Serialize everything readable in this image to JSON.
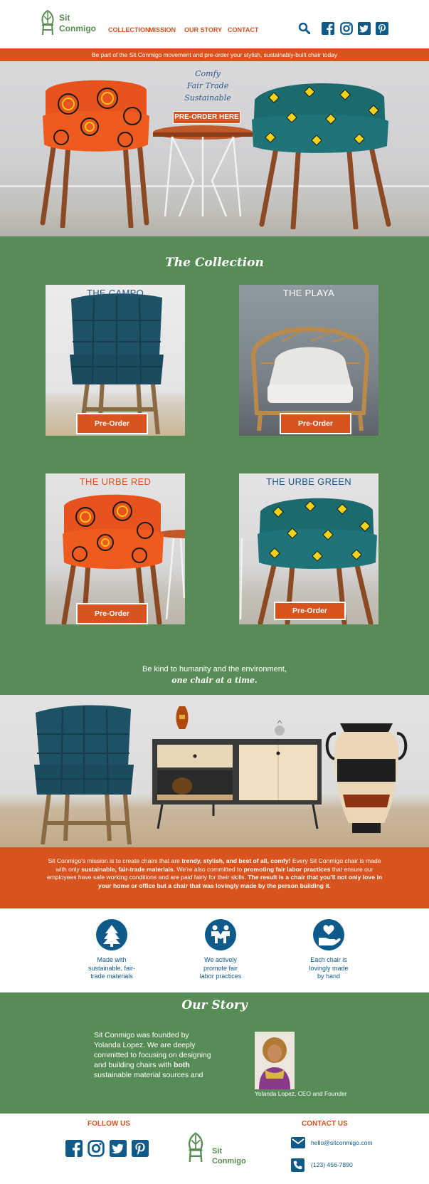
{
  "header": {
    "logo_line1": "Sit",
    "logo_line2": "Conmigo",
    "nav": [
      "COLLECTION",
      "MISSION",
      "OUR STORY",
      "CONTACT"
    ]
  },
  "banner": "Be part of the Sit Conmigo movement and pre-order your stylish, sustainably-built chair today",
  "hero": {
    "tagline": [
      "Comfy",
      "Fair Trade",
      "Sustainable"
    ],
    "cta": "PRE-ORDER HERE"
  },
  "collection": {
    "title": "The Collection",
    "items": [
      {
        "name": "THE CAMPO",
        "button": "Pre-Order"
      },
      {
        "name": "THE PLAYA",
        "button": "Pre-Order"
      },
      {
        "name": "THE URBE RED",
        "button": "Pre-Order"
      },
      {
        "name": "THE URBE GREEN",
        "button": "Pre-Order"
      }
    ],
    "tagline_line1": "Be kind to humanity and the environment,",
    "tagline_line2": "one chair at a time."
  },
  "mission": {
    "p1": "Sit Conmigo's mission is to create chairs that are ",
    "b1": "trendy, stylish, and best of all, comfy!",
    "p2": " Every Sit Conmigo chair is made with only ",
    "b2": "sustainable, fair-trade materials.",
    "p3": " We're also committed to ",
    "b3": "promoting fair labor practices",
    "p4": " that ensure our employees have safe working conditions and are paid fairly for their skills. ",
    "b4": "The result is a chair that you'll not only love in your home or office but a chair that was lovingly made by the person building it."
  },
  "features": [
    {
      "icon": "tree-icon",
      "text": [
        "Made with",
        "sustainable, fair-",
        "trade materials"
      ]
    },
    {
      "icon": "handshake-icon",
      "text": [
        "We actively",
        "promote fair",
        "labor practices"
      ]
    },
    {
      "icon": "heart-hand-icon",
      "text": [
        "Each chair is",
        "lovingly made",
        "by hand"
      ]
    }
  ],
  "story": {
    "title": "Our Story",
    "text_a": "Sit Conmigo was founded by Yolanda Lopez. We are deeply committed to focusing on designing and building chairs with ",
    "text_b": "both",
    "text_c": " sustainable material sources and",
    "caption": "Yolanda Lopez, CEO and Founder"
  },
  "footer": {
    "follow": "FOLLOW US",
    "contact": "CONTACT US",
    "email": "hello@sitconmigo.com",
    "phone": "(123) 456-7890",
    "logo_line1": "Sit",
    "logo_line2": "Conmigo"
  },
  "colors": {
    "green": "#588c57",
    "orange": "#d9531e",
    "blue": "#0e5a8a"
  }
}
